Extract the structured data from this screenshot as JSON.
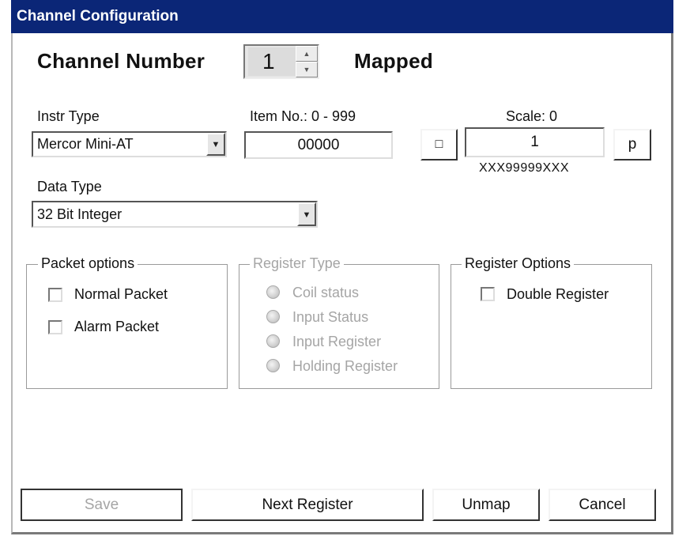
{
  "window": {
    "title": "Channel Configuration"
  },
  "channel": {
    "label": "Channel Number",
    "value": "1",
    "status": "Mapped"
  },
  "instr_type": {
    "label": "Instr Type",
    "value": "Mercor Mini-AT"
  },
  "item_no": {
    "label": "Item No.: 0 - 999",
    "value": "00000"
  },
  "scale": {
    "label": "Scale: 0",
    "value": "1",
    "left_button": "□",
    "right_button": "p",
    "format": "XXX99999XXX"
  },
  "data_type": {
    "label": "Data Type",
    "value": "32 Bit Integer"
  },
  "packet_options": {
    "title": "Packet options",
    "items": [
      {
        "label": "Normal Packet",
        "checked": false
      },
      {
        "label": "Alarm Packet",
        "checked": false
      }
    ]
  },
  "register_type": {
    "title": "Register Type",
    "items": [
      "Coil status",
      "Input Status",
      "Input Register",
      "Holding Register"
    ]
  },
  "register_options": {
    "title": "Register Options",
    "items": [
      {
        "label": "Double Register",
        "checked": false
      }
    ]
  },
  "buttons": {
    "save": "Save",
    "next": "Next Register",
    "unmap": "Unmap",
    "cancel": "Cancel"
  },
  "colors": {
    "titlebar": "#0b2677",
    "disabled_text": "#a5a5a5"
  }
}
